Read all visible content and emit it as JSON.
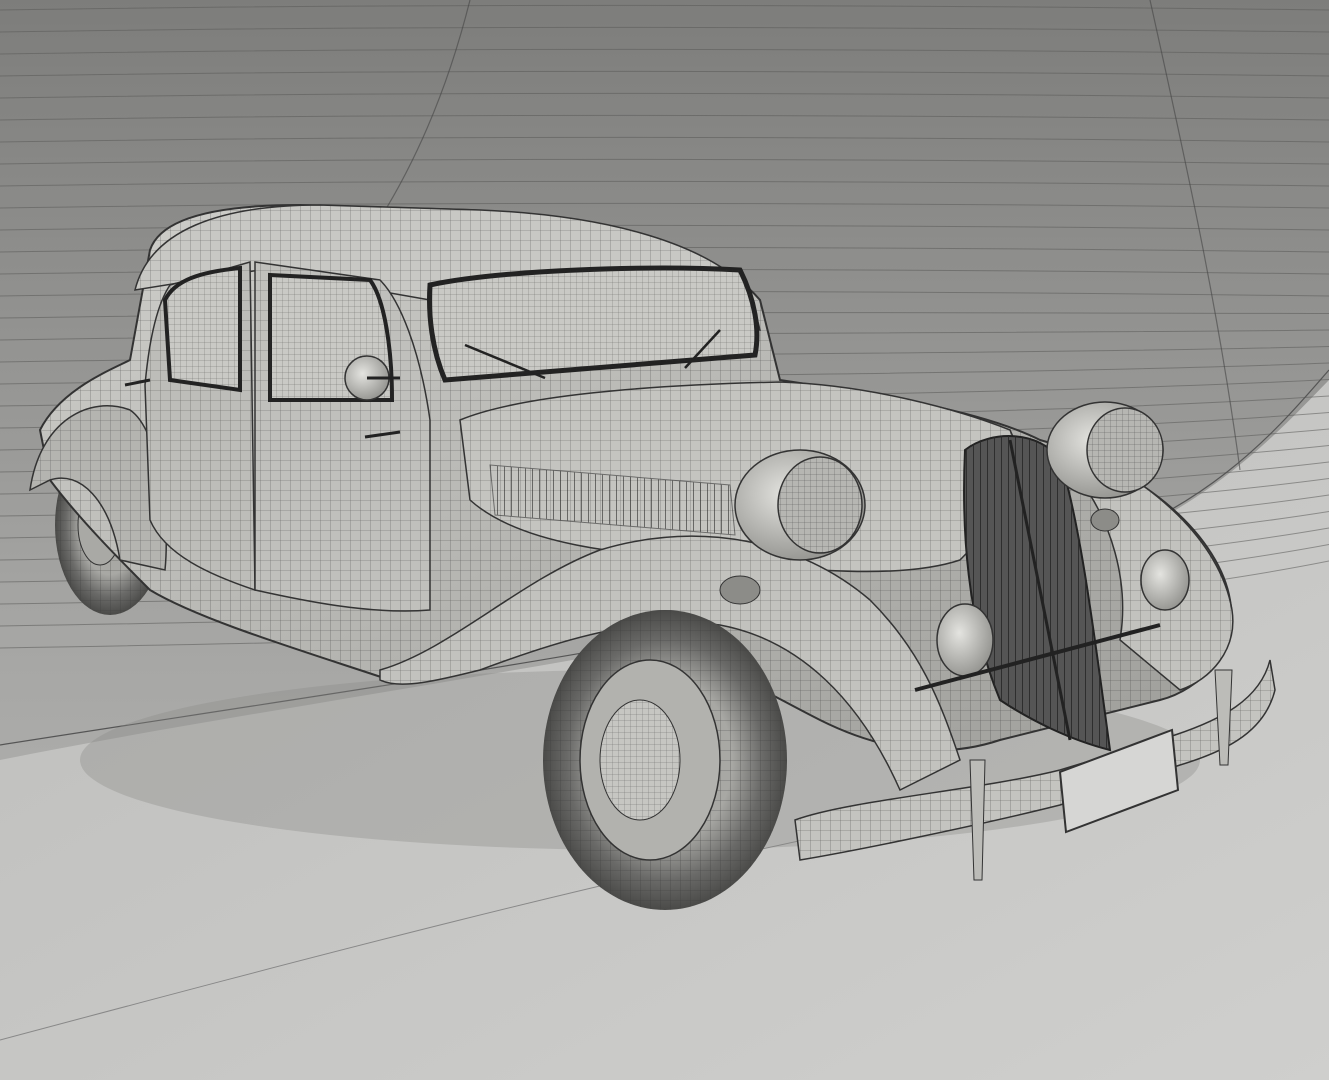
{
  "scene": {
    "subject": "vintage-sedan-wireframe-render",
    "colors": {
      "backdrop_top": "#7f7f7d",
      "backdrop_mid": "#a3a3a1",
      "floor": "#c6c6c4",
      "body": "#bdbdb9",
      "body_shade": "#8d8d89",
      "wire": "#3a3a3a",
      "tire": "#5a5a58",
      "glass": "#c9c9c5",
      "plate": "#d6d6d4"
    }
  }
}
